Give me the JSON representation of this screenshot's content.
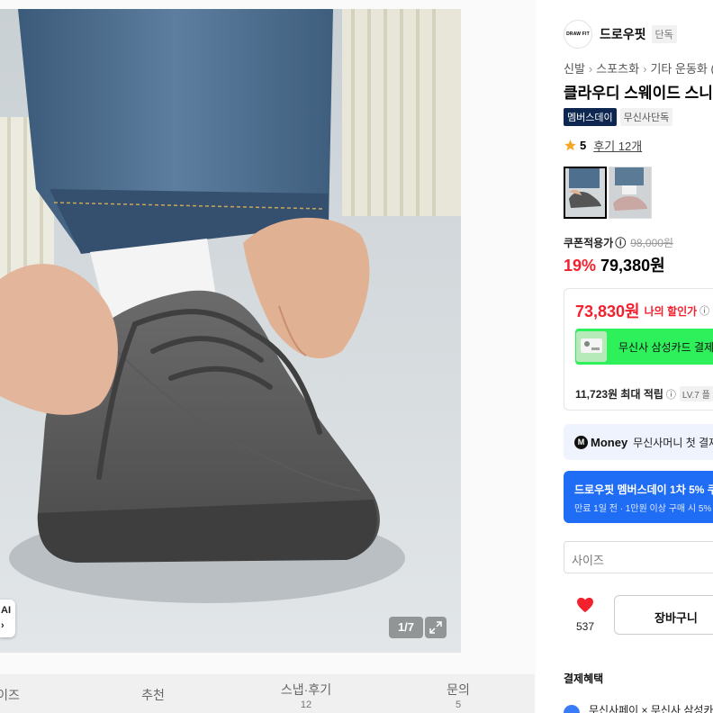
{
  "gallery": {
    "page_counter": "1/7",
    "ai_badge": "AI",
    "ai_arrow": "›",
    "icons": [
      "expand-icon",
      "ai-arrow-icon"
    ]
  },
  "tabs": [
    {
      "label": "이즈",
      "count": ""
    },
    {
      "label": "추천",
      "count": ""
    },
    {
      "label": "스냅·후기",
      "count": "12"
    },
    {
      "label": "문의",
      "count": "5"
    }
  ],
  "brand": {
    "logo_text": "DRAW FIT",
    "name": "드로우핏",
    "tag": "단독"
  },
  "breadcrumb": [
    "신발",
    "스포츠화",
    "기타 운동화 ("
  ],
  "product": {
    "title": "클라우디 스웨이드 스니커",
    "badges": [
      "멤버스데이",
      "무신사단독"
    ]
  },
  "rating": {
    "score": "5",
    "reviews": "후기 12개",
    "star_color": "#f5a623"
  },
  "price": {
    "coupon_label": "쿠폰적용가",
    "info_icon": "ⓘ",
    "original": "98,000원",
    "discount_rate": "19%",
    "sale_price": "79,380원",
    "accent_color": "#f3202d"
  },
  "benefit": {
    "my_price": "73,830원",
    "my_price_label": "나의 할인가",
    "card_banner_text": "무신사 삼성카드 결제",
    "points": "11,723원 최대 적립",
    "level_badge": "LV.7 플"
  },
  "money": {
    "icon_letter": "M",
    "brand": "Money",
    "text": "무신사머니 첫 결제"
  },
  "promo": {
    "title": "드로우핏 멤버스데이 1차 5% 쿠",
    "subtitle": "만료 1일 전 · 1만원 이상 구매 시 5%",
    "color": "#1f6cf5"
  },
  "size_select": {
    "placeholder": "사이즈"
  },
  "actions": {
    "like_count": "537",
    "cart_label": "장바구니"
  },
  "payment": {
    "title": "결제혜택",
    "row": "무신사페이 × 무신사 삼성카"
  }
}
